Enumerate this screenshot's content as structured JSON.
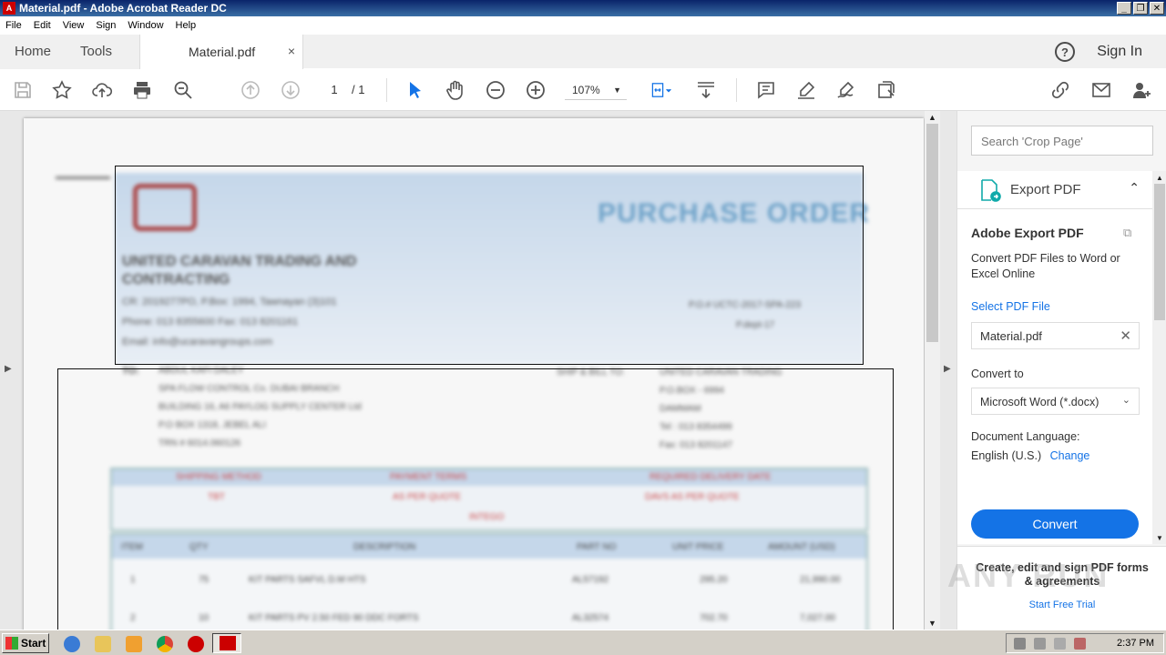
{
  "window": {
    "title": "Material.pdf - Adobe Acrobat Reader DC"
  },
  "menu": [
    "File",
    "Edit",
    "View",
    "Sign",
    "Window",
    "Help"
  ],
  "tabs": {
    "home": "Home",
    "tools": "Tools",
    "doc": "Material.pdf",
    "close": "×"
  },
  "header": {
    "help": "?",
    "signin": "Sign In"
  },
  "toolbar": {
    "page_current": "1",
    "page_total": "/ 1",
    "zoom": "107%"
  },
  "document": {
    "title": "PURCHASE ORDER",
    "company": "UNITED CARAVAN TRADING AND CONTRACTING",
    "lines": [
      "CR: 2019277PO, P.Box: 1994, Tawnayan (3)101",
      "Phone: 013 8355600 Fax: 013 8201161",
      "Email: info@ucaravangroups.com"
    ],
    "ref": [
      "P.O.# UCTC-2017-SPA-223",
      "P.dept-17"
    ],
    "to_label": "TO:",
    "to": [
      "ABDUL KAFI DALEY",
      "SPA FLOW CONTROL Co. DUBAI BRANCH",
      "BUILDING 16, A6 PAYLOG SUPPLY CENTER Ltd",
      "P.O BOX 1318, JEBEL ALI",
      "TRN # 6014.060126"
    ],
    "ship_label": "SHIP & BILL TO:",
    "ship": [
      "UNITED CARAVAN TRADING",
      "P.O.BOX - 6994",
      "DAMMAM",
      "Tel : 013 8354499",
      "Fax: 013 8201147"
    ],
    "terms_head": [
      "SHIPPING METHOD",
      "PAYMENT TERMS",
      "REQUIRED DELIVERY DATE"
    ],
    "terms_vals": [
      "TBT",
      "AS PER QUOTE",
      "DAVS AS PER QUOTE"
    ],
    "terms_extra": "INTEGO",
    "table_head": [
      "ITEM",
      "QTY",
      "DESCRIPTION",
      "PART NO",
      "UNIT PRICE",
      "AMOUNT (USD)"
    ],
    "rows": [
      [
        "1",
        "75",
        "KIT PARTS SAFVL D.M HTS",
        "AL57192",
        "295.20",
        "21,990.00"
      ],
      [
        "2",
        "10",
        "KIT PARTS PV 2.50 FED 90 DDC FORTS",
        "AL32574",
        "702.70",
        "7,027.00"
      ]
    ]
  },
  "rpanel": {
    "search_placeholder": "Search 'Crop Page'",
    "export_label": "Export PDF",
    "ex_title": "Adobe Export PDF",
    "ex_desc": "Convert PDF Files to Word or Excel Online",
    "select_file": "Select PDF File",
    "file": "Material.pdf",
    "convert_to": "Convert to",
    "format": "Microsoft Word (*.docx)",
    "doc_lang": "Document Language:",
    "lang": "English (U.S.)",
    "change": "Change",
    "convert_btn": "Convert",
    "promo": "Create, edit and sign PDF forms & agreements",
    "trial": "Start Free Trial"
  },
  "taskbar": {
    "start": "Start",
    "clock": "2:37 PM"
  },
  "watermark": "ANY RUN"
}
